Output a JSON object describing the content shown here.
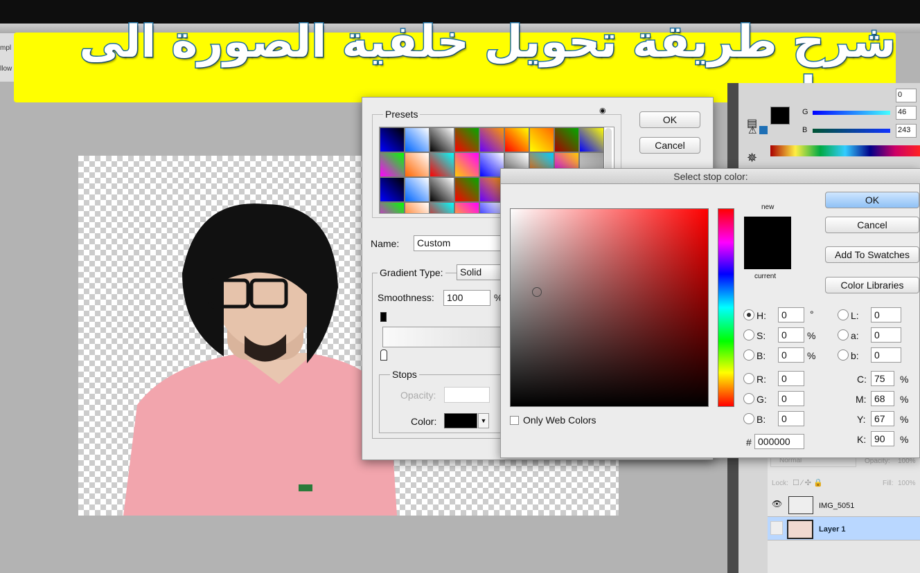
{
  "banner": {
    "title": "شرح طريقة تحويل خلفية الصورة الى بيضاء"
  },
  "left_strip": {
    "items": [
      "mpl",
      "llow"
    ]
  },
  "gradient_editor": {
    "presets_label": "Presets",
    "ok": "OK",
    "cancel": "Cancel",
    "name_label": "Name:",
    "name_value": "Custom",
    "gradient_type_label": "Gradient Type:",
    "gradient_type_value": "Solid",
    "smoothness_label": "Smoothness:",
    "smoothness_value": "100",
    "percent": "%",
    "stops_label": "Stops",
    "opacity_label": "Opacity:",
    "color_label": "Color:",
    "stop_color": "#000000"
  },
  "color_picker": {
    "title": "Select stop color:",
    "ok": "OK",
    "cancel": "Cancel",
    "add_to_swatches": "Add To Swatches",
    "color_libraries": "Color Libraries",
    "new_label": "new",
    "current_label": "current",
    "only_web_colors": "Only Web Colors",
    "hsb": [
      {
        "label": "H:",
        "value": "0",
        "unit": "°",
        "selected": true
      },
      {
        "label": "S:",
        "value": "0",
        "unit": "%"
      },
      {
        "label": "B:",
        "value": "0",
        "unit": "%"
      }
    ],
    "rgb": [
      {
        "label": "R:",
        "value": "0"
      },
      {
        "label": "G:",
        "value": "0"
      },
      {
        "label": "B:",
        "value": "0"
      }
    ],
    "lab": [
      {
        "label": "L:",
        "value": "0"
      },
      {
        "label": "a:",
        "value": "0"
      },
      {
        "label": "b:",
        "value": "0"
      }
    ],
    "cmyk": [
      {
        "label": "C:",
        "value": "75"
      },
      {
        "label": "M:",
        "value": "68"
      },
      {
        "label": "Y:",
        "value": "67"
      },
      {
        "label": "K:",
        "value": "90"
      }
    ],
    "hex_label": "#",
    "hex_value": "000000",
    "new_color": "#000000",
    "current_color": "#000000"
  },
  "color_panel": {
    "r_value": "0",
    "g_label": "G",
    "g_value": "46",
    "b_label": "B",
    "b_value": "243"
  },
  "layers_panel": {
    "blend_mode": "Normal",
    "opacity_label": "Opacity:",
    "opacity_value": "100%",
    "lock_label": "Lock:",
    "fill_label": "Fill:",
    "fill_value": "100%",
    "layers": [
      {
        "name": "IMG_5051",
        "visible": true
      },
      {
        "name": "Layer 1",
        "visible": false,
        "selected": true
      }
    ]
  }
}
